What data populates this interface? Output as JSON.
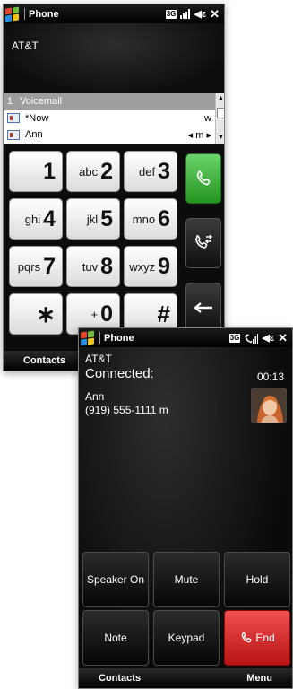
{
  "dialer": {
    "app_title": "Phone",
    "network_badge": "3G",
    "carrier": "AT&T",
    "suggestions": [
      {
        "index": "1",
        "name": "Voicemail",
        "type": "",
        "selected": true
      },
      {
        "index": "",
        "name": "*Now",
        "type": "w",
        "selected": false
      },
      {
        "index": "",
        "name": "Ann",
        "type": "◂ m ▸",
        "selected": false
      }
    ],
    "keys": [
      {
        "letters": "",
        "digit": "1"
      },
      {
        "letters": "abc",
        "digit": "2"
      },
      {
        "letters": "def",
        "digit": "3"
      },
      {
        "letters": "ghi",
        "digit": "4"
      },
      {
        "letters": "jkl",
        "digit": "5"
      },
      {
        "letters": "mno",
        "digit": "6"
      },
      {
        "letters": "pqrs",
        "digit": "7"
      },
      {
        "letters": "tuv",
        "digit": "8"
      },
      {
        "letters": "wxyz",
        "digit": "9"
      },
      {
        "letters": "",
        "digit": "∗"
      },
      {
        "letters": "+",
        "digit": "0"
      },
      {
        "letters": "",
        "digit": "#"
      }
    ],
    "softkey_left": "Contacts",
    "softkey_right": "",
    "colors": {
      "call_green": "#2ea32a",
      "end_red": "#d42424"
    }
  },
  "call": {
    "app_title": "Phone",
    "network_badge": "3G",
    "carrier": "AT&T",
    "status": "Connected:",
    "timer": "00:13",
    "caller_name": "Ann",
    "caller_number": "(919) 555-1111 m",
    "buttons": {
      "speaker": "Speaker On",
      "mute": "Mute",
      "hold": "Hold",
      "note": "Note",
      "keypad": "Keypad",
      "end": "End"
    },
    "softkey_left": "Contacts",
    "softkey_right": "Menu"
  }
}
